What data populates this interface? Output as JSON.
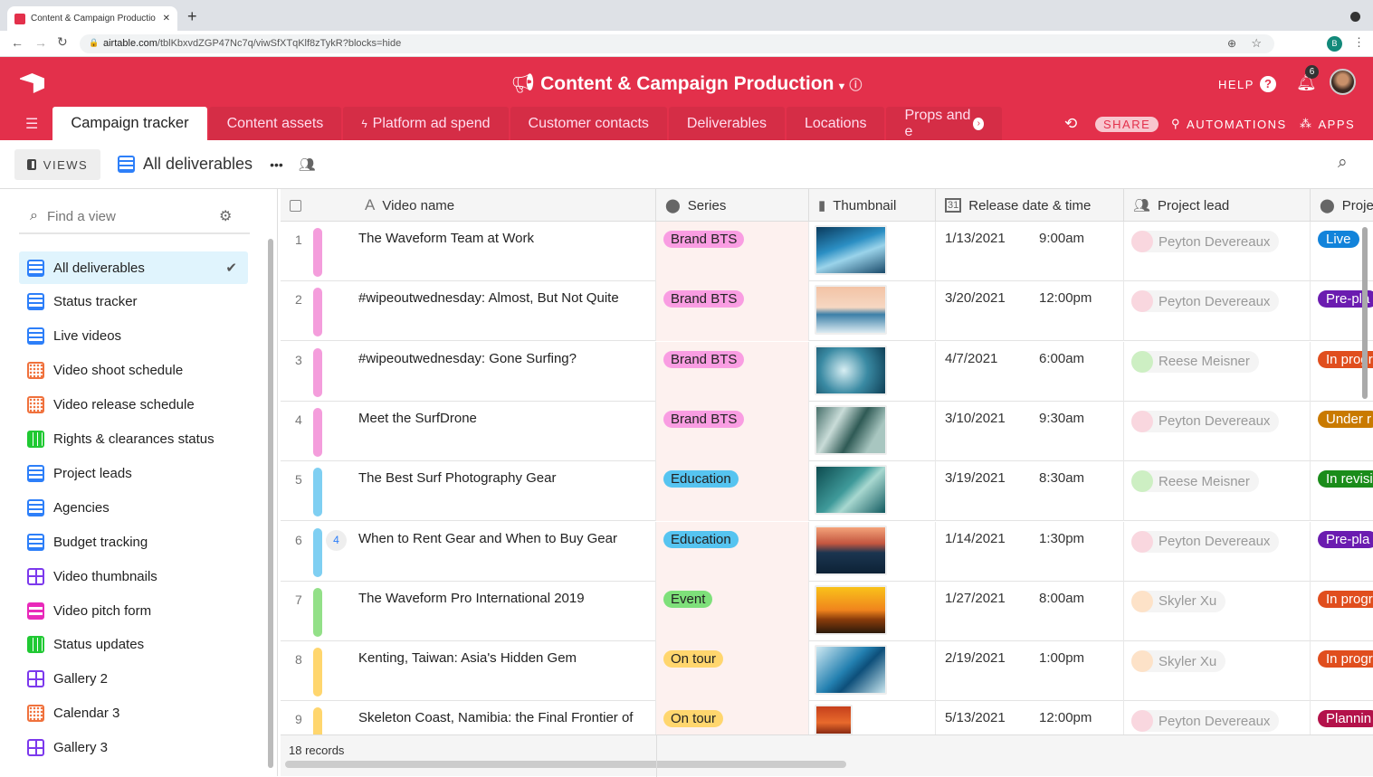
{
  "browser": {
    "tab_title": "Content & Campaign Productio",
    "url_host": "airtable.com",
    "url_path": "/tblKbxvdZGP47Nc7q/viwSfXTqKlf8zTykR?blocks=hide",
    "profile_initial": "B"
  },
  "header": {
    "title": "Content & Campaign Production",
    "help": "HELP",
    "notifications": "6",
    "share": "SHARE",
    "automations": "AUTOMATIONS",
    "apps": "APPS",
    "color": "#e3304b"
  },
  "tabs": [
    {
      "label": "Campaign tracker",
      "active": true
    },
    {
      "label": "Content assets"
    },
    {
      "label": "Platform ad spend"
    },
    {
      "label": "Customer contacts"
    },
    {
      "label": "Deliverables"
    },
    {
      "label": "Locations"
    },
    {
      "label": "Props and e"
    }
  ],
  "viewbar": {
    "views": "VIEWS",
    "current_view": "All deliverables"
  },
  "sidebar": {
    "search_placeholder": "Find a view",
    "items": [
      {
        "label": "All deliverables",
        "type": "grid",
        "active": true
      },
      {
        "label": "Status tracker",
        "type": "grid"
      },
      {
        "label": "Live videos",
        "type": "grid"
      },
      {
        "label": "Video shoot schedule",
        "type": "calendar"
      },
      {
        "label": "Video release schedule",
        "type": "calendar"
      },
      {
        "label": "Rights & clearances status",
        "type": "kanban"
      },
      {
        "label": "Project leads",
        "type": "grid"
      },
      {
        "label": "Agencies",
        "type": "grid"
      },
      {
        "label": "Budget tracking",
        "type": "grid"
      },
      {
        "label": "Video thumbnails",
        "type": "gallery"
      },
      {
        "label": "Video pitch form",
        "type": "form"
      },
      {
        "label": "Status updates",
        "type": "kanban"
      },
      {
        "label": "Gallery 2",
        "type": "gallery"
      },
      {
        "label": "Calendar 3",
        "type": "calendar"
      },
      {
        "label": "Gallery 3",
        "type": "gallery"
      }
    ]
  },
  "columns": [
    "Video name",
    "Series",
    "Thumbnail",
    "Release date & time",
    "Project lead",
    "Proje"
  ],
  "rows": [
    {
      "n": "1",
      "name": "The Waveform Team at Work",
      "series": "Brand BTS",
      "date": "1/13/2021",
      "time": "9:00am",
      "lead": "Peyton Devereaux",
      "status": "Live",
      "status_color": "#1283da",
      "bar": "#f49ddc",
      "thumb": "wave-blue"
    },
    {
      "n": "2",
      "name": "#wipeoutwednesday: Almost, But Not Quite",
      "series": "Brand BTS",
      "date": "3/20/2021",
      "time": "12:00pm",
      "lead": "Peyton Devereaux",
      "status": "Pre-pla",
      "status_color": "#6b1cb0",
      "bar": "#f49ddc",
      "thumb": "sunset-surf"
    },
    {
      "n": "3",
      "name": "#wipeoutwednesday: Gone Surfing?",
      "series": "Brand BTS",
      "date": "4/7/2021",
      "time": "6:00am",
      "lead": "Reese Meisner",
      "status": "In progr",
      "status_color": "#e04e1e",
      "bar": "#f49ddc",
      "thumb": "wave-teal"
    },
    {
      "n": "4",
      "name": "Meet the SurfDrone",
      "series": "Brand BTS",
      "date": "3/10/2021",
      "time": "9:30am",
      "lead": "Peyton Devereaux",
      "status": "Under r",
      "status_color": "#c97a00",
      "bar": "#f49ddc",
      "thumb": "foam"
    },
    {
      "n": "5",
      "name": "The Best Surf Photography Gear",
      "series": "Education",
      "date": "3/19/2021",
      "time": "8:30am",
      "lead": "Reese Meisner",
      "status": "In revisi",
      "status_color": "#1a8c1a",
      "bar": "#7fcff2",
      "thumb": "wave-green"
    },
    {
      "n": "6",
      "name": "When to Rent Gear and When to Buy Gear",
      "series": "Education",
      "date": "1/14/2021",
      "time": "1:30pm",
      "lead": "Peyton Devereaux",
      "status": "Pre-pla",
      "status_color": "#6b1cb0",
      "bar": "#7fcff2",
      "thumb": "dusk",
      "comments": "4"
    },
    {
      "n": "7",
      "name": "The Waveform Pro International 2019",
      "series": "Event",
      "date": "1/27/2021",
      "time": "8:00am",
      "lead": "Skyler Xu",
      "status": "In progr",
      "status_color": "#e04e1e",
      "bar": "#93e088",
      "thumb": "golden"
    },
    {
      "n": "8",
      "name": "Kenting, Taiwan: Asia's Hidden Gem",
      "series": "On tour",
      "date": "2/19/2021",
      "time": "1:00pm",
      "lead": "Skyler Xu",
      "status": "In progr",
      "status_color": "#e04e1e",
      "bar": "#ffd66e",
      "thumb": "wave-curl"
    },
    {
      "n": "9",
      "name": "Skeleton Coast, Namibia: the Final Frontier of",
      "series": "On tour",
      "date": "5/13/2021",
      "time": "12:00pm",
      "lead": "Peyton Devereaux",
      "status": "Plannin",
      "status_color": "#b3124a",
      "bar": "#ffd66e",
      "thumb": "red"
    }
  ],
  "series_colors": {
    "Brand BTS": "#f99de2",
    "Education": "#56c4f0",
    "Event": "#7ee07a",
    "On tour": "#ffd66e"
  },
  "footer": {
    "records": "18 records"
  }
}
